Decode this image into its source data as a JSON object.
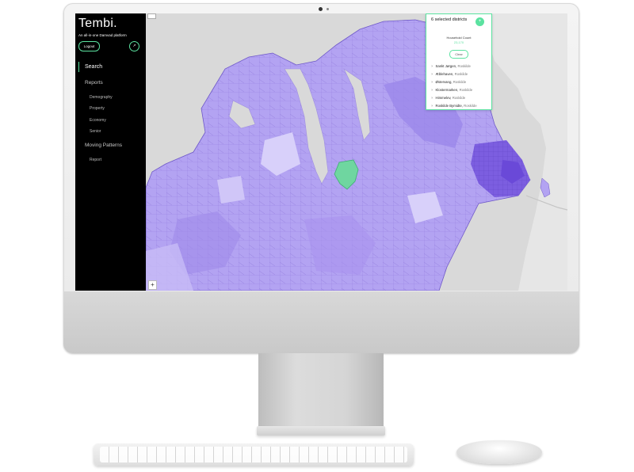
{
  "app": {
    "logo": "Tembi.",
    "tagline": "An all-in-one Damvad platform",
    "logout_label": "Logout",
    "arrow_symbol": "↗"
  },
  "nav": {
    "search": "Search",
    "reports": "Reports",
    "report_items": [
      "Demography",
      "Property",
      "Economy",
      "Senior"
    ],
    "moving_patterns": "Moving Patterns",
    "moving_items": [
      "Report"
    ]
  },
  "panel": {
    "title": "6 selected districts",
    "add_symbol": "+",
    "metric_label": "Household Count",
    "metric_value": "23,170",
    "clear_label": "Clear",
    "remove_symbol": "×",
    "districts": [
      {
        "name": "Sankt Jørgen",
        "city": "Roskilde"
      },
      {
        "name": "Æblehaven",
        "city": "Roskilde"
      },
      {
        "name": "Østervang",
        "city": "Roskilde"
      },
      {
        "name": "Klostermarken",
        "city": "Roskilde"
      },
      {
        "name": "Himmelev",
        "city": "Roskilde"
      },
      {
        "name": "Roskilde Bymidte",
        "city": "Roskilde"
      }
    ]
  },
  "map": {
    "zoom_in": "+"
  },
  "colors": {
    "accent": "#5be2a0",
    "sidebar_bg": "#000000",
    "district_fill": "#a996f0",
    "water": "#dadada",
    "selected_fill": "#6fd6a0"
  }
}
